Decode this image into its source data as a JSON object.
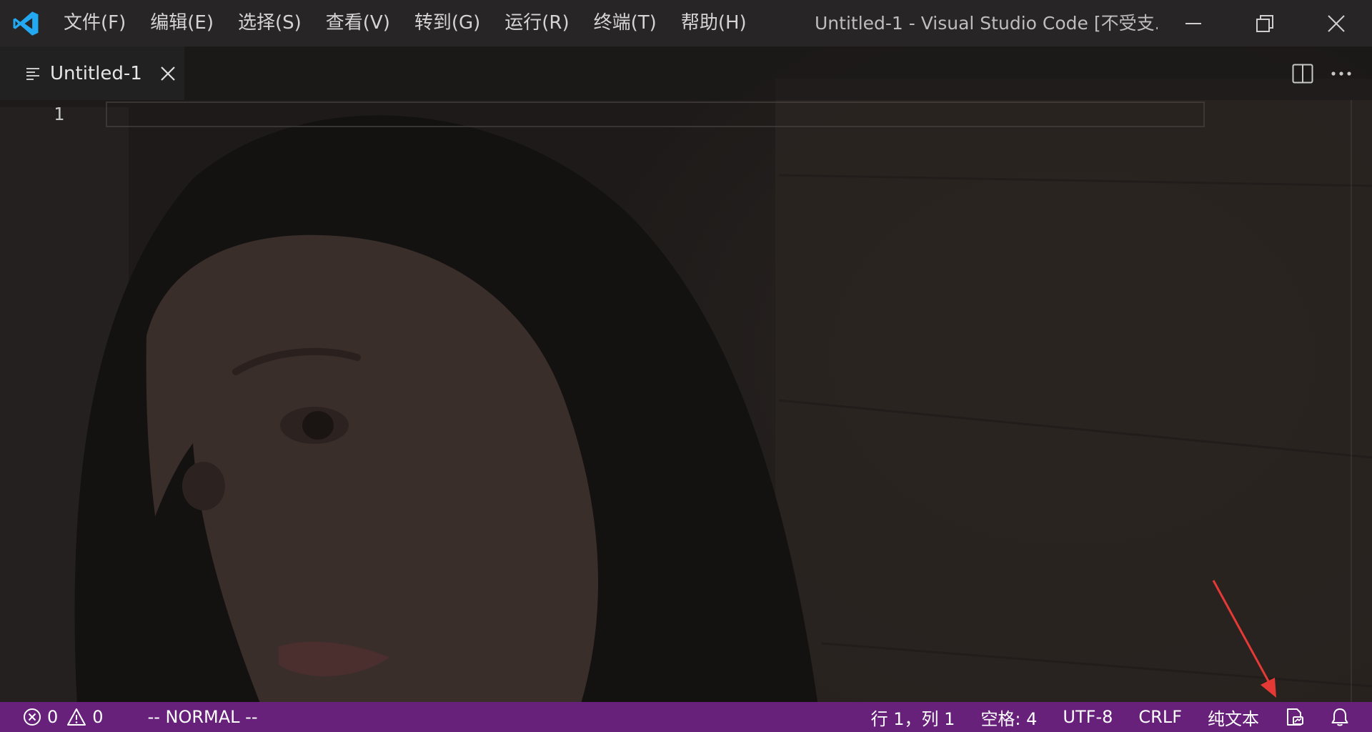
{
  "window": {
    "title": "Untitled-1 - Visual Studio Code [不受支..."
  },
  "menu": {
    "items": [
      {
        "label": "文件(F)"
      },
      {
        "label": "编辑(E)"
      },
      {
        "label": "选择(S)"
      },
      {
        "label": "查看(V)"
      },
      {
        "label": "转到(G)"
      },
      {
        "label": "运行(R)"
      },
      {
        "label": "终端(T)"
      },
      {
        "label": "帮助(H)"
      }
    ]
  },
  "tabs": [
    {
      "label": "Untitled-1",
      "icon": "plain-text-file-icon",
      "active": true
    }
  ],
  "editor": {
    "line_numbers": [
      "1"
    ]
  },
  "statusbar": {
    "errors": "0",
    "warnings": "0",
    "vim_mode": "-- NORMAL --",
    "cursor_position": "行 1，列 1",
    "indentation": "空格: 4",
    "encoding": "UTF-8",
    "eol": "CRLF",
    "language": "纯文本"
  },
  "colors": {
    "statusbar_bg": "#68217a",
    "vscode_blue": "#23a9f2",
    "annotation_red": "#e53935"
  },
  "icons": [
    "vscode-logo-icon",
    "minimize-icon",
    "restore-icon",
    "close-icon",
    "split-editor-icon",
    "more-actions-icon",
    "error-icon",
    "warning-icon",
    "feedback-icon",
    "bell-icon"
  ]
}
